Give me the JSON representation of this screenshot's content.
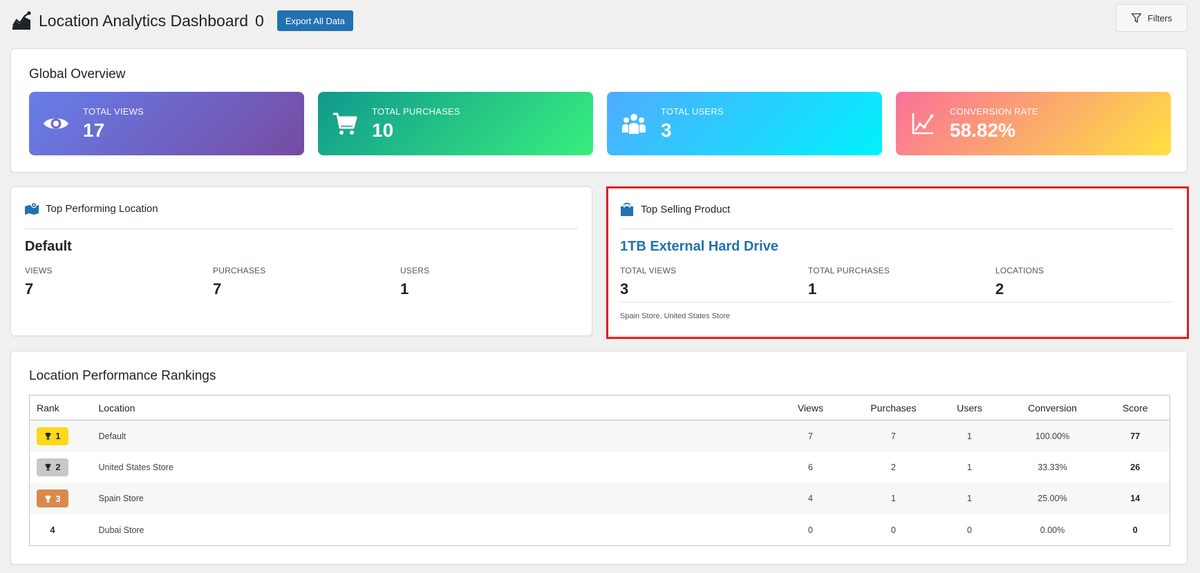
{
  "header": {
    "title": "Location Analytics Dashboard",
    "count": "0",
    "export_label": "Export All Data",
    "filters_label": "Filters"
  },
  "overview": {
    "title": "Global Overview",
    "stats": [
      {
        "label": "TOTAL VIEWS",
        "value": "17",
        "icon": "eye-icon"
      },
      {
        "label": "TOTAL PURCHASES",
        "value": "10",
        "icon": "cart-icon"
      },
      {
        "label": "TOTAL USERS",
        "value": "3",
        "icon": "users-icon"
      },
      {
        "label": "CONVERSION RATE",
        "value": "58.82%",
        "icon": "chart-line-icon"
      }
    ]
  },
  "top_location": {
    "title": "Top Performing Location",
    "name": "Default",
    "metrics": [
      {
        "label": "VIEWS",
        "value": "7"
      },
      {
        "label": "PURCHASES",
        "value": "7"
      },
      {
        "label": "USERS",
        "value": "1"
      }
    ]
  },
  "top_product": {
    "title": "Top Selling Product",
    "name": "1TB External Hard Drive",
    "metrics": [
      {
        "label": "TOTAL VIEWS",
        "value": "3"
      },
      {
        "label": "TOTAL PURCHASES",
        "value": "1"
      },
      {
        "label": "LOCATIONS",
        "value": "2"
      }
    ],
    "locations_text": "Spain Store, United States Store"
  },
  "rankings": {
    "title": "Location Performance Rankings",
    "columns": [
      "Rank",
      "Location",
      "Views",
      "Purchases",
      "Users",
      "Conversion",
      "Score"
    ],
    "rows": [
      {
        "rank": "1",
        "location": "Default",
        "views": "7",
        "purchases": "7",
        "users": "1",
        "conversion": "100.00%",
        "score": "77"
      },
      {
        "rank": "2",
        "location": "United States Store",
        "views": "6",
        "purchases": "2",
        "users": "1",
        "conversion": "33.33%",
        "score": "26"
      },
      {
        "rank": "3",
        "location": "Spain Store",
        "views": "4",
        "purchases": "1",
        "users": "1",
        "conversion": "25.00%",
        "score": "14"
      },
      {
        "rank": "4",
        "location": "Dubai Store",
        "views": "0",
        "purchases": "0",
        "users": "0",
        "conversion": "0.00%",
        "score": "0"
      }
    ]
  },
  "colors": {
    "accent": "#2271b1",
    "highlight": "#dc1f26",
    "gold": "#ffd81b",
    "silver": "#c8c8c8",
    "bronze": "#d98a4a"
  }
}
